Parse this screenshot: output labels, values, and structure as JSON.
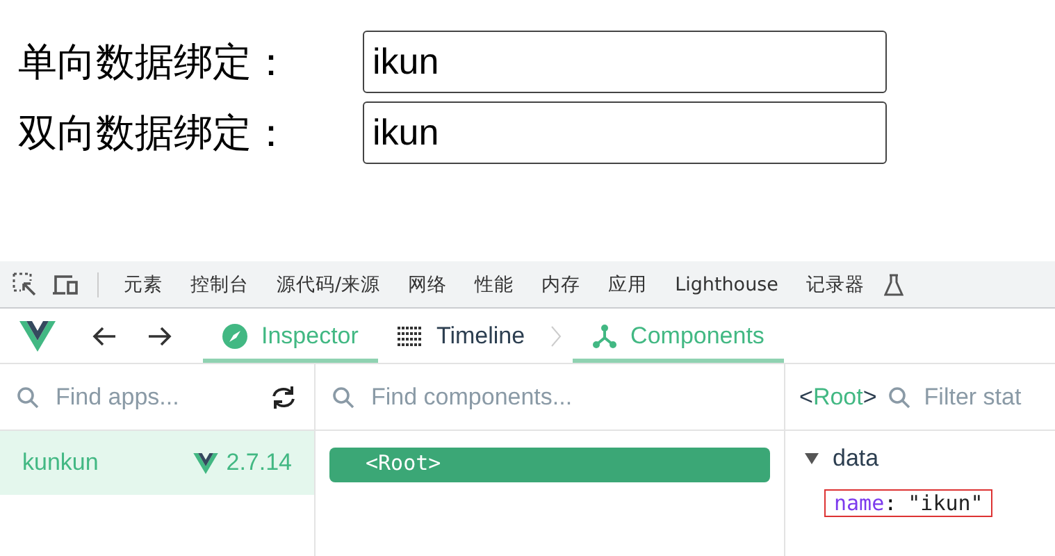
{
  "form": {
    "rows": [
      {
        "label": "单向数据绑定：",
        "value": "ikun"
      },
      {
        "label": "双向数据绑定：",
        "value": "ikun"
      }
    ]
  },
  "devtools_tabs": [
    {
      "label": "元素",
      "selected": false
    },
    {
      "label": "控制台",
      "selected": false
    },
    {
      "label": "源代码/来源",
      "selected": false
    },
    {
      "label": "网络",
      "selected": false
    },
    {
      "label": "性能",
      "selected": false
    },
    {
      "label": "内存",
      "selected": false
    },
    {
      "label": "应用",
      "selected": false
    },
    {
      "label": "Lighthouse",
      "selected": false
    },
    {
      "label": "记录器",
      "selected": false
    }
  ],
  "vue_tabs": [
    {
      "kind": "inspector",
      "label": "Inspector",
      "selected": true
    },
    {
      "kind": "timeline",
      "label": "Timeline",
      "selected": false
    },
    {
      "kind": "components",
      "label": "Components",
      "selected": true
    }
  ],
  "apps_pane": {
    "search": {
      "placeholder": "Find apps..."
    },
    "apps": [
      {
        "name": "kunkun",
        "version": "2.7.14",
        "selected": true
      }
    ]
  },
  "components_pane": {
    "search": {
      "placeholder": "Find components..."
    },
    "tree": [
      {
        "label": "<Root>",
        "selected": true
      }
    ]
  },
  "state_pane": {
    "crumb": {
      "open": "<",
      "name": "Root",
      "close": ">"
    },
    "search": {
      "placeholder": "Filter stat"
    },
    "sections": [
      {
        "title": "data",
        "expanded": true,
        "fields": [
          {
            "key": "name",
            "sep": ":",
            "value": "\"ikun\"",
            "highlighted": true
          }
        ]
      }
    ]
  }
}
